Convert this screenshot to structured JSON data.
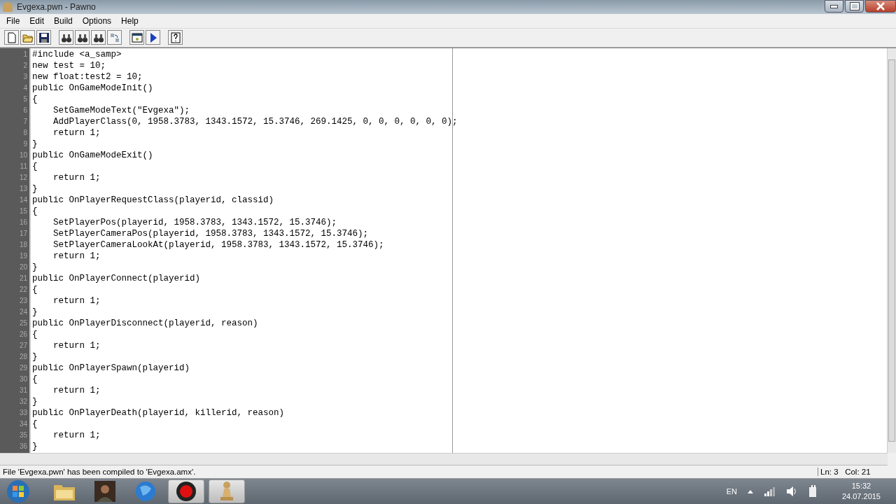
{
  "window": {
    "title": "Evgexa.pwn - Pawno"
  },
  "menu": [
    "File",
    "Edit",
    "Build",
    "Options",
    "Help"
  ],
  "editor": {
    "lines": [
      {
        "number": "1",
        "code": "#include <a_samp>"
      },
      {
        "number": "2",
        "code": "new test = 10;"
      },
      {
        "number": "3",
        "code": "new float:test2 = 10;"
      },
      {
        "number": "4",
        "code": "public OnGameModeInit()"
      },
      {
        "number": "5",
        "code": "{"
      },
      {
        "number": "6",
        "code": "    SetGameModeText(\"Evgexa\");"
      },
      {
        "number": "7",
        "code": "    AddPlayerClass(0, 1958.3783, 1343.1572, 15.3746, 269.1425, 0, 0, 0, 0, 0, 0);"
      },
      {
        "number": "8",
        "code": "    return 1;"
      },
      {
        "number": "9",
        "code": "}"
      },
      {
        "number": "10",
        "code": "public OnGameModeExit()"
      },
      {
        "number": "11",
        "code": "{"
      },
      {
        "number": "12",
        "code": "    return 1;"
      },
      {
        "number": "13",
        "code": "}"
      },
      {
        "number": "14",
        "code": "public OnPlayerRequestClass(playerid, classid)"
      },
      {
        "number": "15",
        "code": "{"
      },
      {
        "number": "16",
        "code": "    SetPlayerPos(playerid, 1958.3783, 1343.1572, 15.3746);"
      },
      {
        "number": "17",
        "code": "    SetPlayerCameraPos(playerid, 1958.3783, 1343.1572, 15.3746);"
      },
      {
        "number": "18",
        "code": "    SetPlayerCameraLookAt(playerid, 1958.3783, 1343.1572, 15.3746);"
      },
      {
        "number": "19",
        "code": "    return 1;"
      },
      {
        "number": "20",
        "code": "}"
      },
      {
        "number": "21",
        "code": "public OnPlayerConnect(playerid)"
      },
      {
        "number": "22",
        "code": "{"
      },
      {
        "number": "23",
        "code": "    return 1;"
      },
      {
        "number": "24",
        "code": "}"
      },
      {
        "number": "25",
        "code": "public OnPlayerDisconnect(playerid, reason)"
      },
      {
        "number": "26",
        "code": "{"
      },
      {
        "number": "27",
        "code": "    return 1;"
      },
      {
        "number": "28",
        "code": "}"
      },
      {
        "number": "29",
        "code": "public OnPlayerSpawn(playerid)"
      },
      {
        "number": "30",
        "code": "{"
      },
      {
        "number": "31",
        "code": "    return 1;"
      },
      {
        "number": "32",
        "code": "}"
      },
      {
        "number": "33",
        "code": "public OnPlayerDeath(playerid, killerid, reason)"
      },
      {
        "number": "34",
        "code": "{"
      },
      {
        "number": "35",
        "code": "    return 1;"
      },
      {
        "number": "36",
        "code": "}"
      }
    ]
  },
  "status_bar": {
    "message": "File 'Evgexa.pwn' has been compiled to 'Evgexa.amx'.",
    "position": "Ln: 3   Col: 21"
  },
  "taskbar": {
    "items": [
      {
        "kind": "folder",
        "selected": false
      },
      {
        "kind": "avatar",
        "selected": false
      },
      {
        "kind": "browser",
        "selected": false
      },
      {
        "kind": "record",
        "selected": true
      },
      {
        "kind": "pawn",
        "selected": true
      }
    ],
    "language": "EN",
    "time": "15:32",
    "date": "24.07.2015"
  }
}
